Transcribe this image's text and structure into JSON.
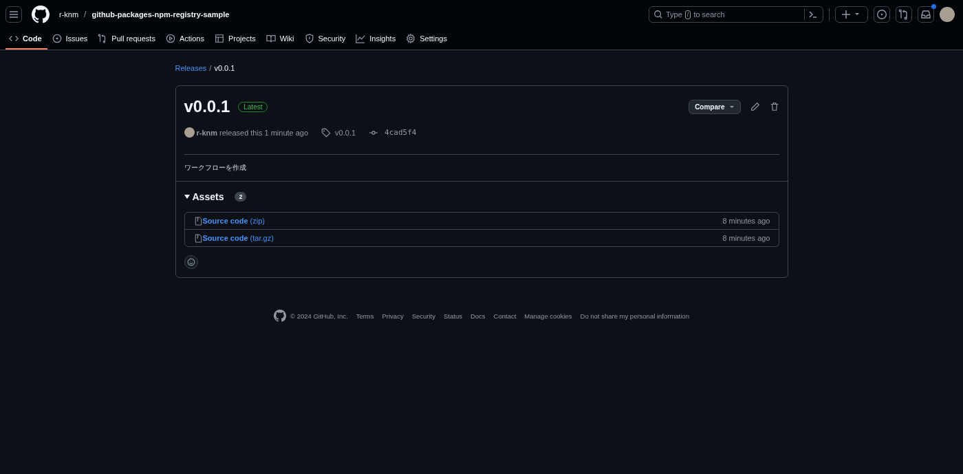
{
  "header": {
    "owner": "r-knm",
    "separator": "/",
    "repo": "github-packages-npm-registry-sample",
    "search": {
      "prefix": "Type",
      "key": "/",
      "suffix": "to search"
    },
    "notification_unread": true
  },
  "tabs": [
    {
      "label": "Code",
      "selected": true
    },
    {
      "label": "Issues",
      "selected": false
    },
    {
      "label": "Pull requests",
      "selected": false
    },
    {
      "label": "Actions",
      "selected": false
    },
    {
      "label": "Projects",
      "selected": false
    },
    {
      "label": "Wiki",
      "selected": false
    },
    {
      "label": "Security",
      "selected": false
    },
    {
      "label": "Insights",
      "selected": false
    },
    {
      "label": "Settings",
      "selected": false
    }
  ],
  "breadcrumb": {
    "parent": "Releases",
    "separator": "/",
    "current": "v0.0.1"
  },
  "release": {
    "title": "v0.0.1",
    "badge": "Latest",
    "compare_button": "Compare",
    "author": "r-knm",
    "released_text": "released this 1 minute ago",
    "tag": "v0.0.1",
    "commit": "4cad5f4",
    "description": "ワークフローを作成",
    "assets": {
      "title": "Assets",
      "count": "2",
      "expanded": true,
      "items": [
        {
          "name": "**Source code** (zip)",
          "time": "8 minutes ago"
        },
        {
          "name": "**Source code** (tar.gz)",
          "time": "8 minutes ago"
        }
      ]
    }
  },
  "footer": {
    "copyright": "© 2024 GitHub, Inc.",
    "links": [
      "Terms",
      "Privacy",
      "Security",
      "Status",
      "Docs",
      "Contact",
      "Manage cookies",
      "Do not share my personal information"
    ]
  }
}
